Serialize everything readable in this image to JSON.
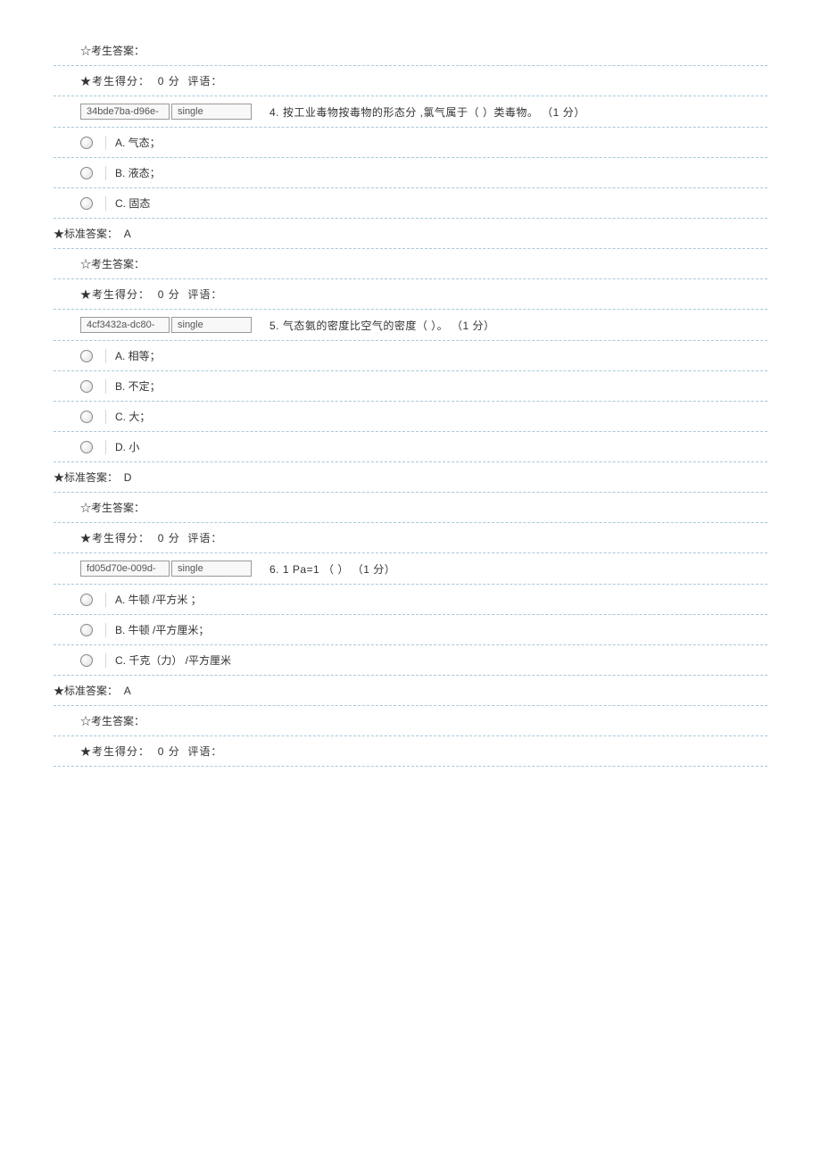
{
  "labels": {
    "examinee_answer": "☆考生答案：",
    "score_prefix": "★考生得分：",
    "score_val": "0 分",
    "comment_prefix": "评语：",
    "standard_answer_prefix": "★标准答案："
  },
  "q4": {
    "id": "34bde7ba-d96e-",
    "type": "single",
    "text": "4. 按工业毒物按毒物的形态分   ,氯气属于（  ）类毒物。  （1 分）",
    "opts": {
      "a": "A. 气态；",
      "b": "B. 液态；",
      "c": "C. 固态"
    },
    "answer": "A"
  },
  "q5": {
    "id": "4cf3432a-dc80-",
    "type": "single",
    "text": "5. 气态氨的密度比空气的密度（    ）。 （1 分）",
    "opts": {
      "a": "A. 相等；",
      "b": "B. 不定；",
      "c": "C. 大；",
      "d": "D. 小"
    },
    "answer": "D"
  },
  "q6": {
    "id": "fd05d70e-009d-",
    "type": "single",
    "text": "6. 1 Pa=1 （  ） （1 分）",
    "opts": {
      "a": "A. 牛顿 /平方米  ；",
      "b": "B. 牛顿 /平方厘米；",
      "c": "C. 千克（力） /平方厘米"
    },
    "answer": "A"
  }
}
